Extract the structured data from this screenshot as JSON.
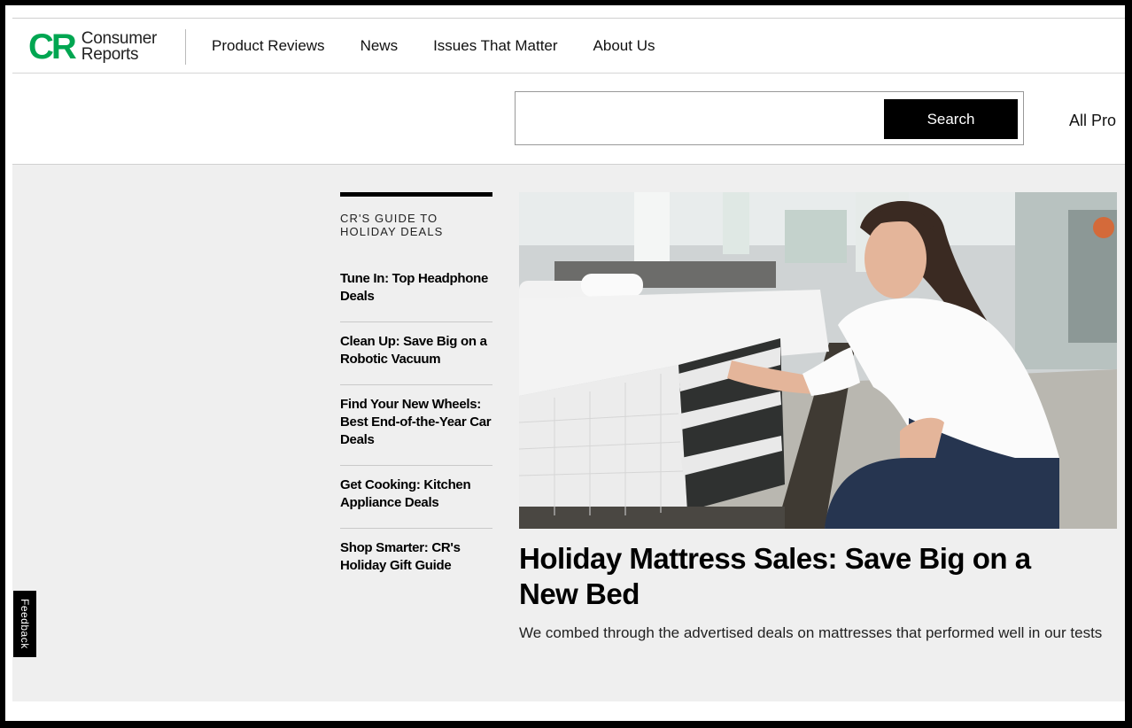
{
  "logo": {
    "mark": "CR",
    "line1": "Consumer",
    "line2": "Reports"
  },
  "nav": [
    {
      "label": "Product Reviews"
    },
    {
      "label": "News"
    },
    {
      "label": "Issues That Matter"
    },
    {
      "label": "About Us"
    }
  ],
  "search": {
    "value": "",
    "placeholder": "",
    "button_label": "Search"
  },
  "all_products_label": "All Pro",
  "guide": {
    "title": "CR'S GUIDE TO HOLIDAY DEALS",
    "links": [
      {
        "label": "Tune In: Top Headphone Deals"
      },
      {
        "label": "Clean Up: Save Big on a Robotic Vacuum"
      },
      {
        "label": "Find Your New Wheels: Best End-of-the-Year Car Deals"
      },
      {
        "label": "Get Cooking: Kitchen Appliance Deals"
      },
      {
        "label": "Shop Smarter: CR's Holiday Gift Guide"
      }
    ]
  },
  "hero": {
    "title": "Holiday Mattress Sales: Save Big on a New Bed",
    "description": "We combed through the advertised deals on mattresses that performed well in our tests"
  },
  "feedback_label": "Feedback",
  "colors": {
    "brand_green": "#00a651",
    "button_black": "#000000",
    "content_bg": "#efefef"
  }
}
